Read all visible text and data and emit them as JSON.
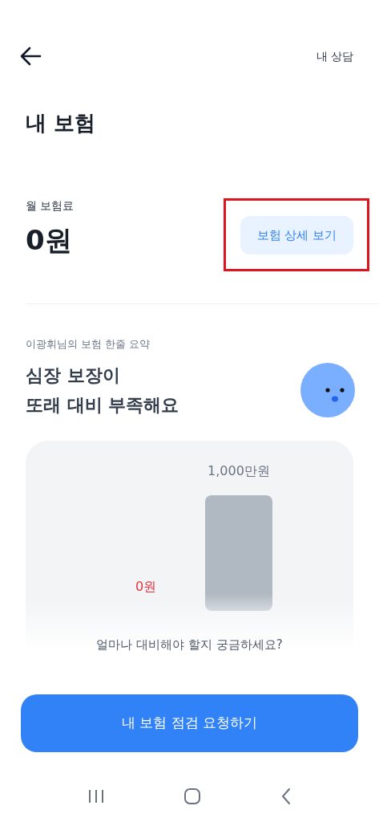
{
  "header": {
    "link": "내 상담"
  },
  "title": "내 보험",
  "premium": {
    "label": "월 보험료",
    "amount": "0원",
    "button": {
      "label": "보험 상세 보기",
      "highlighted": true
    }
  },
  "summary": {
    "caption": "이광휘님의 보험 한줄 요약",
    "headline": [
      "심장 보장이",
      "또래 대비 부족해요"
    ]
  },
  "comparison": {
    "bars": [
      {
        "value_label": "0원",
        "kind": "empty",
        "color": "#e0323c"
      },
      {
        "value_label": "1,000만원",
        "kind": "bar",
        "color": "#6b7280"
      }
    ],
    "question": "얼마나 대비해야 할지 궁금하세요?"
  },
  "cta": "내 보험 점검 요청하기"
}
